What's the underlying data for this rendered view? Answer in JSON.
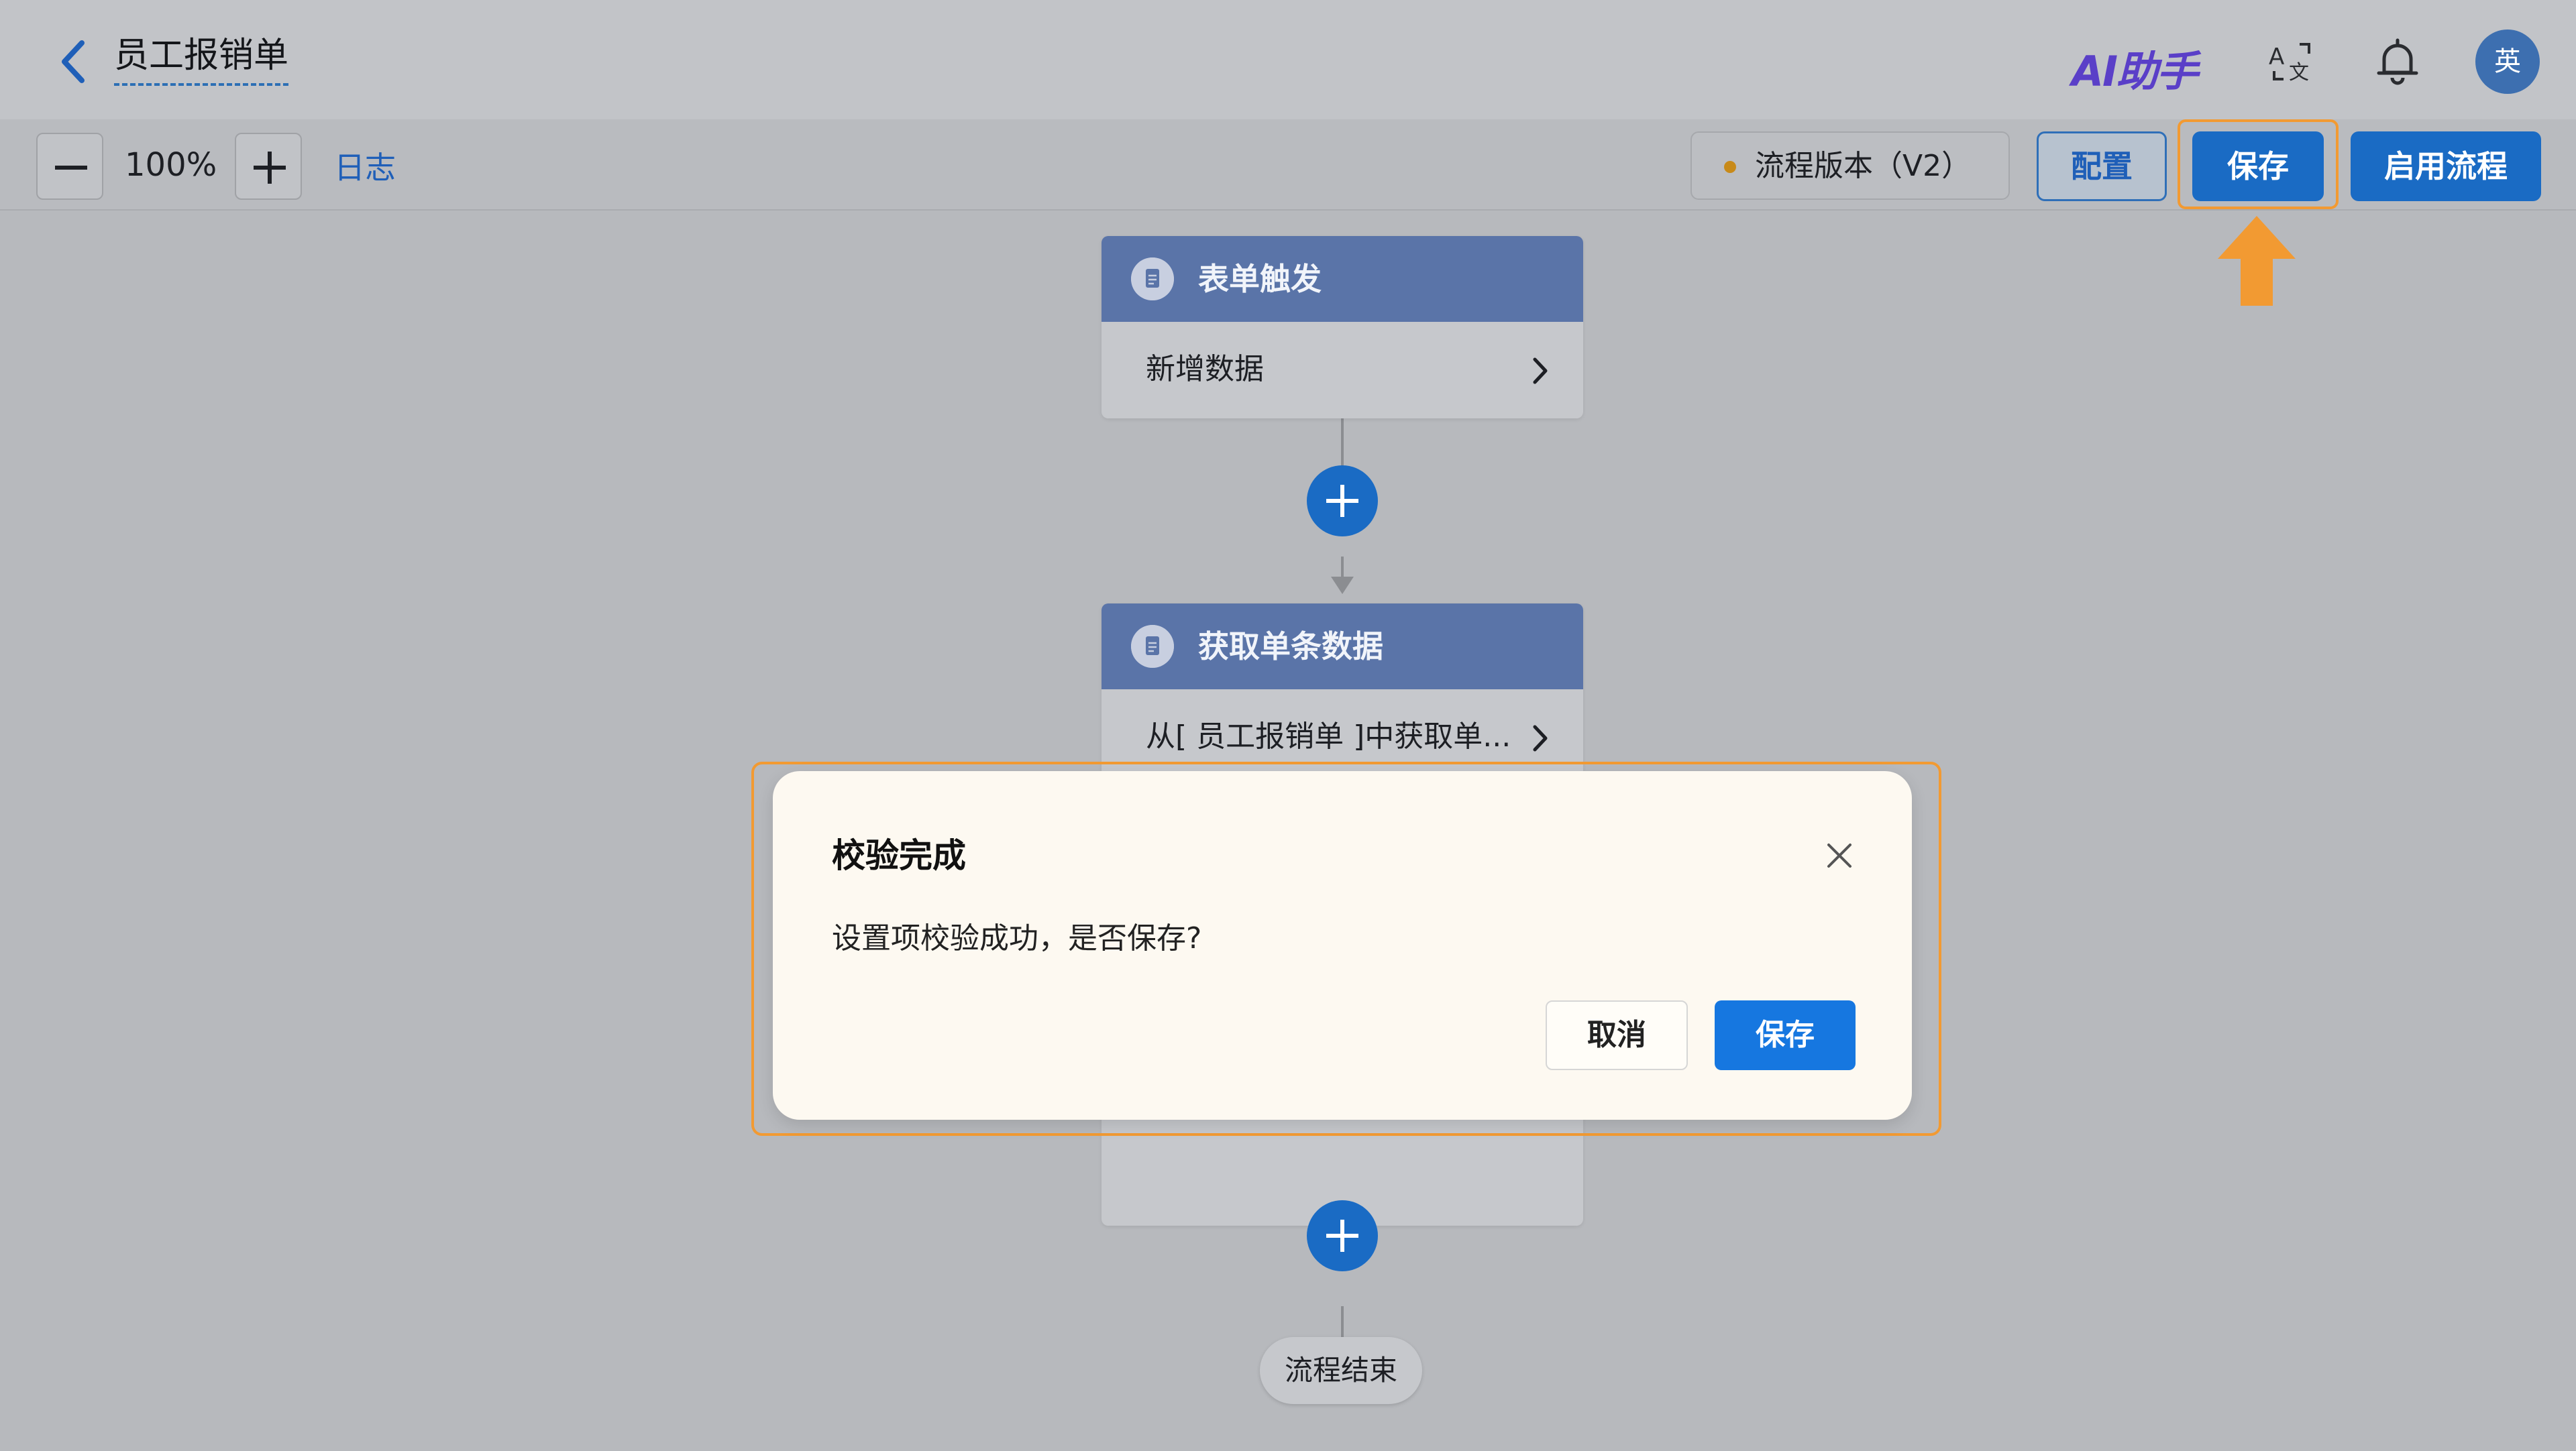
{
  "header": {
    "title": "员工报销单",
    "ai_assistant_label": "AI助手",
    "avatar_text": "英",
    "icons": [
      "back-arrow-icon",
      "translate-icon",
      "bell-icon"
    ]
  },
  "toolbar": {
    "zoom_level": "100%",
    "log_label": "日志",
    "version_label": "流程版本（V2）",
    "version_dot_color": "#c88a19",
    "config_label": "配置",
    "save_label": "保存",
    "enable_label": "启用流程"
  },
  "flow": {
    "nodes": [
      {
        "title": "表单触发",
        "description": "新增数据",
        "icon": "document-icon"
      },
      {
        "title": "获取单条数据",
        "description": "从[ 员工报销单 ]中获取单...",
        "icon": "document-icon"
      }
    ],
    "end_label": "流程结束"
  },
  "dialog": {
    "title": "校验完成",
    "message": "设置项校验成功，是否保存?",
    "cancel_label": "取消",
    "save_label": "保存"
  },
  "colors": {
    "accent": "#1a6bc4",
    "node_header": "#5a74a8",
    "highlight": "#f29a32",
    "dialog_bg": "#fdf9f1"
  }
}
